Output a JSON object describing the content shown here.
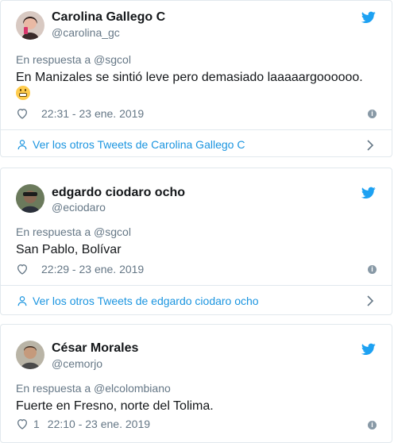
{
  "tweets": [
    {
      "name": "Carolina Gallego C",
      "handle": "@carolina_gc",
      "reply_to": "En respuesta a @sgcol",
      "text": "En Manizales se sintió leve pero demasiado laaaaargoooooo.",
      "emoji": "grimacing-face-emoji",
      "likes": "",
      "timestamp": "22:31 - 23 ene. 2019",
      "more_link": "Ver los otros Tweets de Carolina Gallego C"
    },
    {
      "name": "edgardo ciodaro ocho",
      "handle": "@eciodaro",
      "reply_to": "En respuesta a @sgcol",
      "text": "San Pablo, Bolívar",
      "likes": "",
      "timestamp": "22:29 - 23 ene. 2019",
      "more_link": "Ver los otros Tweets de edgardo ciodaro ocho"
    },
    {
      "name": "César Morales",
      "handle": "@cemorjo",
      "reply_to": "En respuesta a @elcolombiano",
      "text": "Fuerte en Fresno, norte del Tolima.",
      "likes": "1",
      "timestamp": "22:10 - 23 ene. 2019"
    }
  ],
  "colors": {
    "twitter_blue": "#1da1f2",
    "link_blue": "#1b95e0",
    "muted": "#657786",
    "border": "#e1e8ed"
  },
  "icons": [
    "twitter-bird-icon",
    "heart-icon",
    "info-icon",
    "person-icon",
    "chevron-right-icon"
  ]
}
